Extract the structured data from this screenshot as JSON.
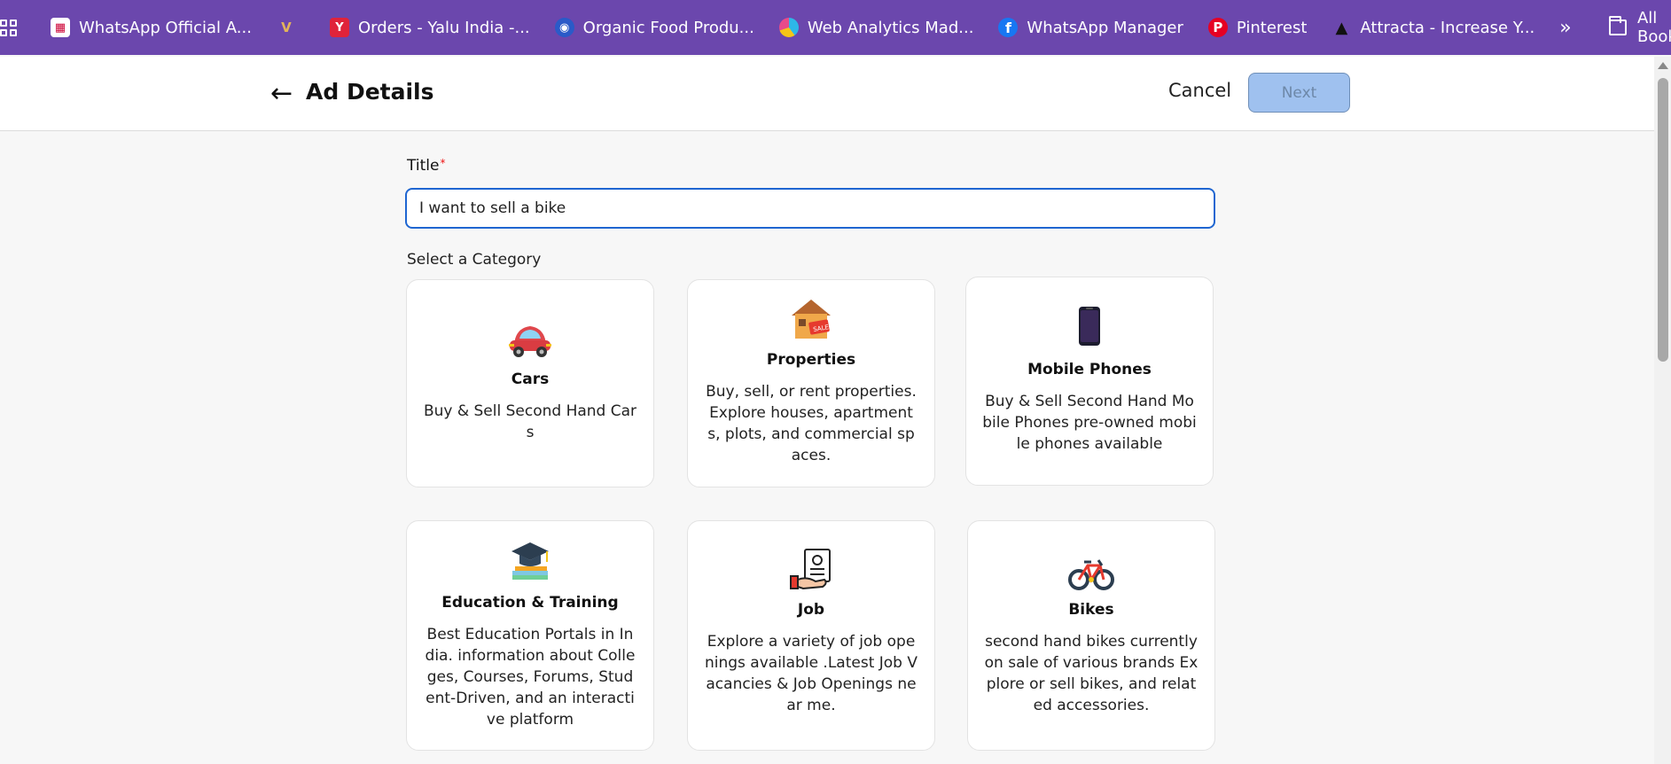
{
  "bookmarks": {
    "items": [
      {
        "label": "WhatsApp Official A...",
        "icon": "calendar-logo-icon",
        "color": "#ffffff",
        "glyph": "W"
      },
      {
        "label": "",
        "icon": "vault-logo-icon",
        "color": "#c4a05a",
        "glyph": "V"
      },
      {
        "label": "Orders - Yalu India -...",
        "icon": "yalu-logo-icon",
        "color": "#e0233a",
        "glyph": "Y"
      },
      {
        "label": "Organic Food Produ...",
        "icon": "organic-globe-icon",
        "color": "#2a5ac8",
        "glyph": "O"
      },
      {
        "label": "Web Analytics Mad...",
        "icon": "analytics-pie-icon",
        "color": "#2db7e8",
        "glyph": "W"
      },
      {
        "label": "WhatsApp Manager",
        "icon": "facebook-icon",
        "color": "#1877f2",
        "glyph": "f"
      },
      {
        "label": "Pinterest",
        "icon": "pinterest-icon",
        "color": "#e60023",
        "glyph": "P"
      },
      {
        "label": "Attracta - Increase Y...",
        "icon": "attracta-icon",
        "color": "#222222",
        "glyph": "A"
      }
    ],
    "more_label": "»",
    "all_bookmarks": "All Bookmarks"
  },
  "header": {
    "back_icon": "←",
    "title": "Ad Details",
    "cancel_label": "Cancel",
    "next_label": "Next"
  },
  "form": {
    "title_label": "Title",
    "required_mark": "*",
    "title_value": "I want to sell a bike",
    "category_label": "Select a Category"
  },
  "categories": [
    {
      "title": "Cars",
      "description": "Buy & Sell Second Hand Cars",
      "icon": "car-icon"
    },
    {
      "title": "Properties",
      "description": "Buy, sell, or rent properties. Explore houses, apartments, plots, and commercial spaces.",
      "icon": "house-sale-icon"
    },
    {
      "title": "Mobile Phones",
      "description": "Buy & Sell Second Hand Mobile Phones pre-owned mobile phones available",
      "icon": "smartphone-icon"
    },
    {
      "title": "Education & Training",
      "description": "Best Education Portals in India. information about Colleges, Courses, Forums, Student-Driven, and an interactive platform",
      "icon": "graduation-cap-icon"
    },
    {
      "title": "Job",
      "description": "Explore a variety of job openings available .Latest Job Vacancies & Job Openings near me.",
      "icon": "job-resume-icon"
    },
    {
      "title": "Bikes",
      "description": "second hand bikes currently on sale of various brands Explore or sell bikes, and related accessories.",
      "icon": "bicycle-icon"
    }
  ],
  "colors": {
    "bookmark_bar": "#6b47ad",
    "input_focus": "#1f66d1",
    "next_disabled": "#9fc1ef",
    "required": "#e11111"
  }
}
